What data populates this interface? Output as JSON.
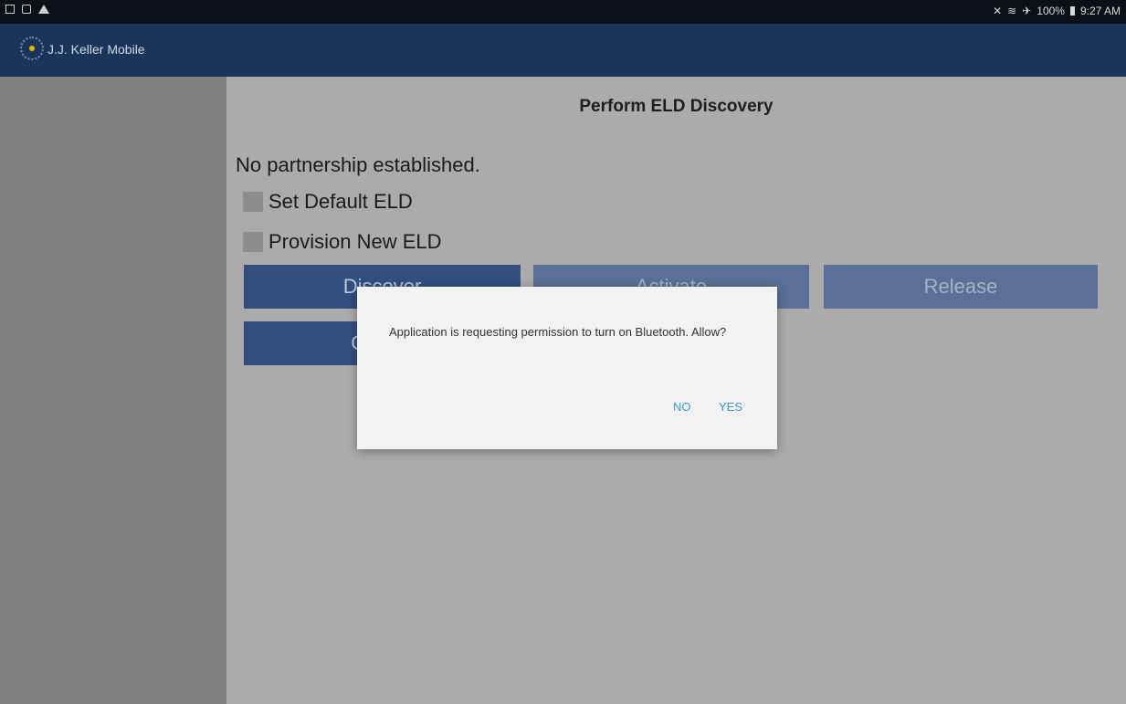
{
  "status_bar": {
    "time": "9:27 AM",
    "battery": "100%",
    "icons": [
      "screenshot-icon",
      "sim-icon",
      "warning-icon",
      "bluetooth-icon",
      "wifi-icon",
      "airplane-icon",
      "battery-icon"
    ]
  },
  "app_bar": {
    "title": "J.J. Keller Mobile"
  },
  "main": {
    "title": "Perform  ELD Discovery",
    "status": "No partnership established.",
    "checkboxes": [
      {
        "label": "Set Default ELD",
        "checked": false
      },
      {
        "label": "Provision New ELD",
        "checked": false
      }
    ],
    "buttons": {
      "discover": "Discover",
      "activate": "Activate",
      "release": "Release",
      "cancel": "Cancel"
    }
  },
  "dialog": {
    "message": "Application is requesting permission to turn on Bluetooth. Allow?",
    "no_label": "NO",
    "yes_label": "YES"
  }
}
